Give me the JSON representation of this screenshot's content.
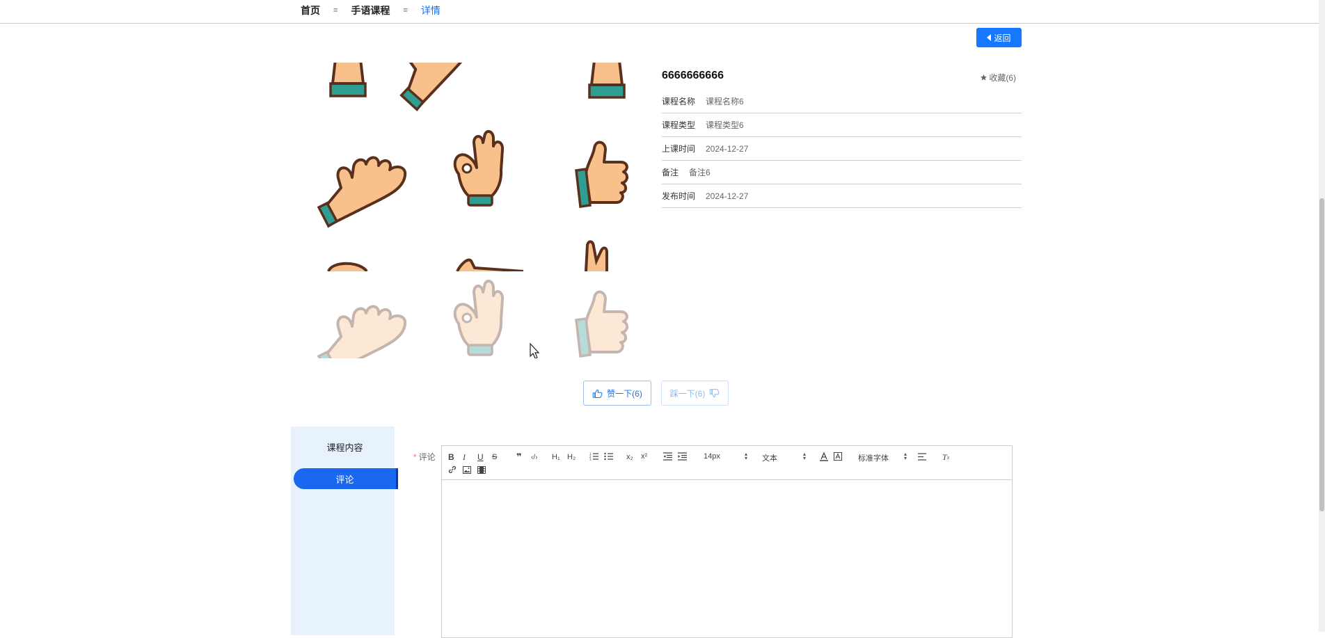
{
  "breadcrumb": {
    "items": [
      "首页",
      "手语课程",
      "详情"
    ],
    "separator": "≡"
  },
  "back_button": {
    "label": "返回"
  },
  "course": {
    "title": "6666666666",
    "favorite_label": "收藏(6)",
    "fields": [
      {
        "label": "课程名称",
        "value": "课程名称6"
      },
      {
        "label": "课程类型",
        "value": "课程类型6"
      },
      {
        "label": "上课时间",
        "value": "2024-12-27"
      },
      {
        "label": "备注",
        "value": "备注6"
      },
      {
        "label": "发布时间",
        "value": "2024-12-27"
      }
    ]
  },
  "reactions": {
    "like_label": "赞一下(6)",
    "dislike_label": "踩一下(6)"
  },
  "tabs": [
    {
      "label": "课程内容",
      "active": false
    },
    {
      "label": "评论",
      "active": true
    }
  ],
  "comment": {
    "required_mark": "*",
    "label": "评论",
    "toolbar": {
      "size_select": "14px",
      "header_select": "文本",
      "font_select": "标准字体"
    }
  },
  "colors": {
    "primary": "#1677ff",
    "tab_active": "#1a67f0",
    "sidebar_bg": "#e8f2fd",
    "required": "#f56c6c"
  }
}
